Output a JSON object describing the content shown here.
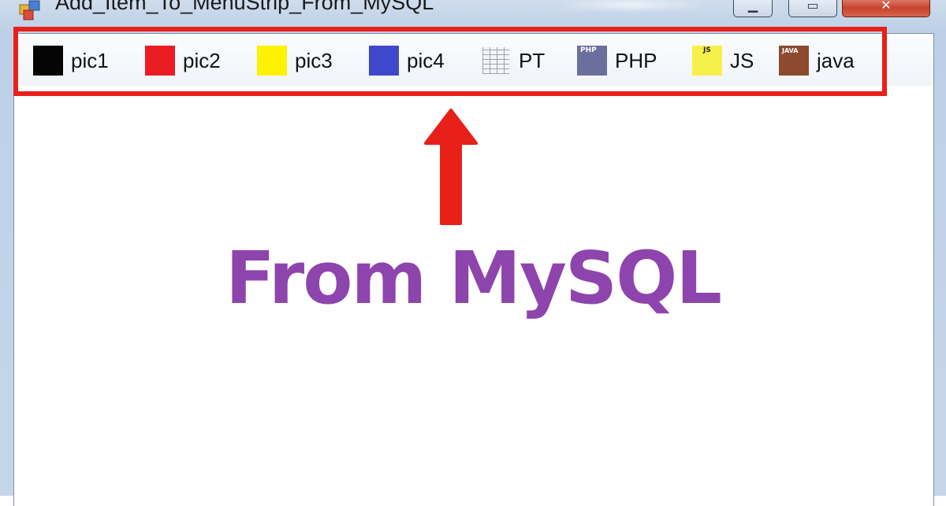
{
  "window": {
    "title": "Add_Item_To_MenuStrip_From_MySQL",
    "icons": {
      "app": "form-icon",
      "minimize": "minimize-icon",
      "maximize": "maximize-icon",
      "close": "close-icon"
    }
  },
  "menu": {
    "items": [
      {
        "label": "pic1",
        "icon": "black-square-icon",
        "color": "#050505"
      },
      {
        "label": "pic2",
        "icon": "red-square-icon",
        "color": "#ec1c24"
      },
      {
        "label": "pic3",
        "icon": "yellow-square-icon",
        "color": "#fff200"
      },
      {
        "label": "pic4",
        "icon": "blue-square-icon",
        "color": "#3f48cc"
      },
      {
        "label": "PT",
        "icon": "table-icon",
        "color": "#f4f5f7"
      },
      {
        "label": "PHP",
        "icon": "php-logo-icon",
        "color": "#6a6f9e",
        "icon_text": "PHP"
      },
      {
        "label": "JS",
        "icon": "js-logo-icon",
        "color": "#f7f04a",
        "icon_text": "JS"
      },
      {
        "label": "java",
        "icon": "java-logo-icon",
        "color": "#8c4a2f",
        "icon_text": "JAVA"
      }
    ]
  },
  "annotation": {
    "text": "From MySQL",
    "text_color": "#8e44ad",
    "highlight_color": "#e8201a",
    "arrow_color": "#e8201a"
  }
}
